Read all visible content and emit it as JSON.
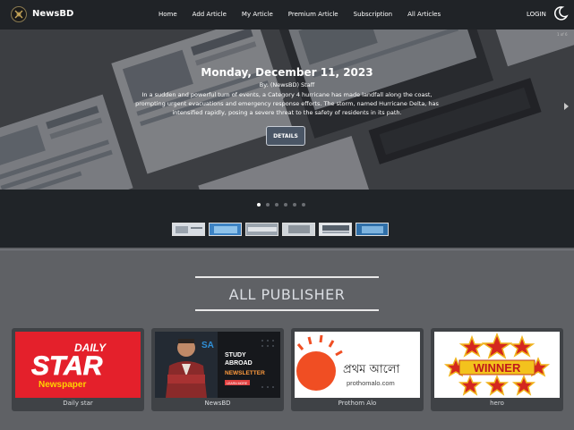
{
  "nav": {
    "brand": "NewsBD",
    "items": [
      "Home",
      "Add Article",
      "My Article",
      "Premium Article",
      "Subscription",
      "All Articles"
    ],
    "login": "LOGIN"
  },
  "hero": {
    "date": "Monday, December 11, 2023",
    "author": "By: (NewsBD) Staff",
    "text": "In a sudden and powerful turn of events, a Category 4 hurricane has made landfall along the coast, prompting urgent evacuations and emergency response efforts. The storm, named Hurricane Delta, has intensified rapidly, posing a severe threat to the safety of residents in its path.",
    "button": "DETAILS",
    "counter": "1 of 6",
    "slide_count": 6,
    "active_slide": 1
  },
  "publishers": {
    "title": "ALL PUBLISHER",
    "items": [
      {
        "name": "Daily star",
        "logo_line1": "DAILY",
        "logo_line2": "STAR",
        "logo_line3": "Newspaper"
      },
      {
        "name": "NewsBD",
        "logo_sa": "SA",
        "logo_line1": "STUDY",
        "logo_line2": "ABROAD",
        "logo_line3": "NEWSLETTER",
        "logo_cta": "LEARN MORE"
      },
      {
        "name": "Prothom Alo",
        "logo_bangla": "প্রথম আলো",
        "logo_url": "prothomalo.com"
      },
      {
        "name": "hero",
        "logo_word": "WINNER"
      }
    ]
  },
  "colors": {
    "nav_bg": "#202327",
    "page_bg": "#5f6165",
    "card_bg": "#3f4246",
    "daily_star_red": "#e4202b",
    "prothom_orange": "#f04e23"
  },
  "icons": [
    "logo-icon",
    "moon-icon",
    "chevron-right-icon"
  ]
}
